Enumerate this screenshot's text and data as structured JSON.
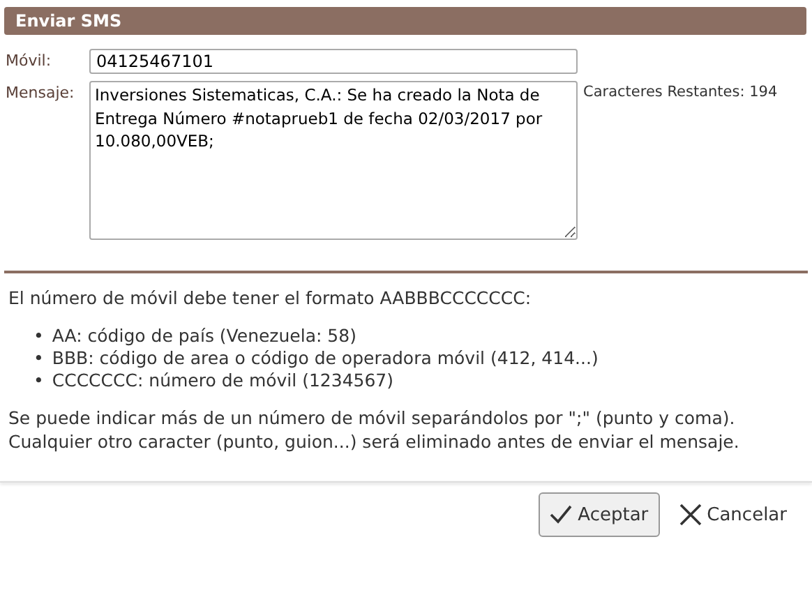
{
  "header": {
    "title": "Enviar SMS"
  },
  "form": {
    "mobile_label": "Móvil:",
    "mobile_value": "04125467101",
    "message_label": "Mensaje:",
    "message_value": "Inversiones Sistematicas, C.A.: Se ha creado la Nota de Entrega Número #notaprueb1 de fecha 02/03/2017 por 10.080,00VEB;",
    "remaining": "Caracteres Restantes: 194"
  },
  "help": {
    "intro": "El número de móvil debe tener el formato AABBBCCCCCCC:",
    "items": [
      {
        "bullet": "•",
        "text": "AA: código de país (Venezuela: 58)"
      },
      {
        "bullet": "•",
        "text": "BBB: código de area o código de operadora móvil (412, 414...)"
      },
      {
        "bullet": "•",
        "text": "CCCCCCC: número de móvil (1234567)"
      }
    ],
    "note": "Se puede indicar más de un número de móvil separándolos por \";\" (punto y coma). Cualquier otro caracter (punto, guion...) será eliminado antes de enviar el mensaje."
  },
  "buttons": [
    {
      "kind": "accept",
      "label": "Aceptar"
    },
    {
      "kind": "cancel",
      "label": "Cancelar"
    }
  ]
}
